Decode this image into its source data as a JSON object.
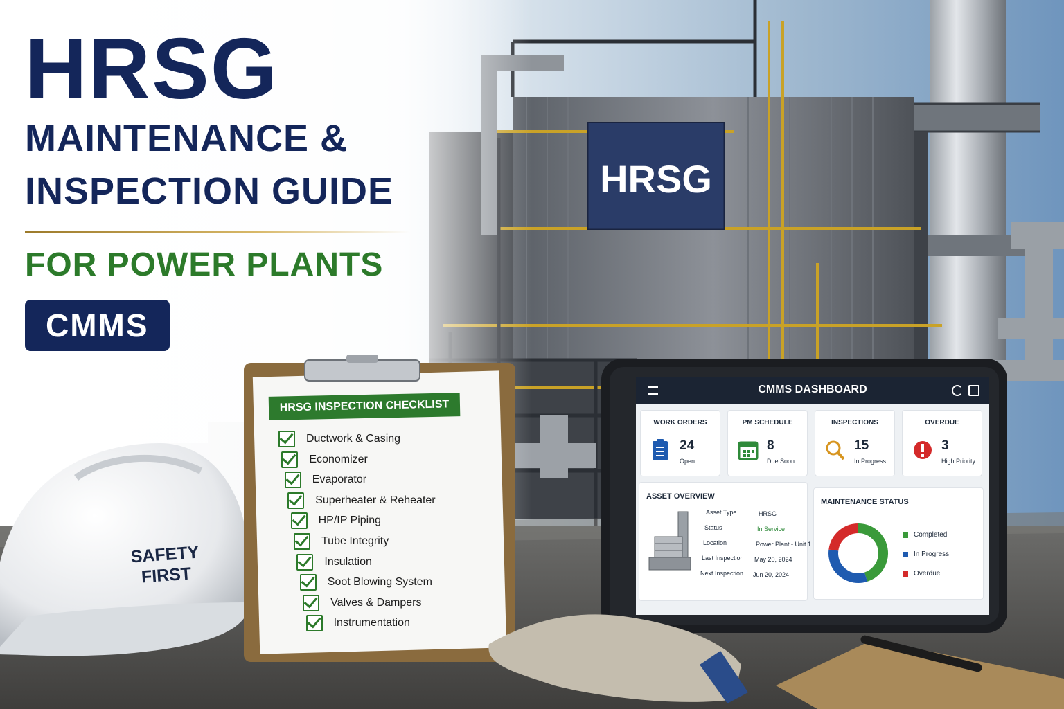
{
  "title": {
    "line1": "HRSG",
    "line2": "MAINTENANCE &",
    "line3": "INSPECTION GUIDE",
    "subtitle": "FOR POWER PLANTS",
    "badge": "CMMS"
  },
  "plant_sign": "HRSG",
  "hard_hat": {
    "line1": "SAFETY",
    "line2": "FIRST"
  },
  "checklist": {
    "title": "HRSG INSPECTION CHECKLIST",
    "items": [
      "Ductwork & Casing",
      "Economizer",
      "Evaporator",
      "Superheater & Reheater",
      "HP/IP Piping",
      "Tube Integrity",
      "Insulation",
      "Soot Blowing System",
      "Valves & Dampers",
      "Instrumentation"
    ]
  },
  "dashboard": {
    "title": "CMMS DASHBOARD",
    "cards": [
      {
        "label": "WORK ORDERS",
        "value": "24",
        "sub": "Open",
        "icon": "clipboard-list-icon",
        "color": "#1f5bb0"
      },
      {
        "label": "PM SCHEDULE",
        "value": "8",
        "sub": "Due Soon",
        "icon": "calendar-icon",
        "color": "#2f8a3a"
      },
      {
        "label": "INSPECTIONS",
        "value": "15",
        "sub": "In Progress",
        "icon": "magnifier-icon",
        "color": "#d79520"
      },
      {
        "label": "OVERDUE",
        "value": "3",
        "sub": "High Priority",
        "icon": "alert-icon",
        "color": "#d42a2a"
      }
    ],
    "asset_overview": {
      "title": "ASSET OVERVIEW",
      "rows": [
        {
          "key": "Asset Type",
          "value": "HRSG"
        },
        {
          "key": "Status",
          "value": "In Service"
        },
        {
          "key": "Location",
          "value": "Power Plant - Unit 1"
        },
        {
          "key": "Last Inspection",
          "value": "May 20, 2024"
        },
        {
          "key": "Next Inspection",
          "value": "Jun 20, 2024"
        }
      ],
      "status_color": "#2f8a3a"
    },
    "maintenance_status": {
      "title": "MAINTENANCE STATUS",
      "segments": [
        {
          "label": "Completed",
          "fraction": 0.45,
          "color": "#3a9a3a"
        },
        {
          "label": "In Progress",
          "fraction": 0.32,
          "color": "#1f5bb0"
        },
        {
          "label": "Overdue",
          "fraction": 0.23,
          "color": "#d42a2a"
        }
      ]
    }
  }
}
